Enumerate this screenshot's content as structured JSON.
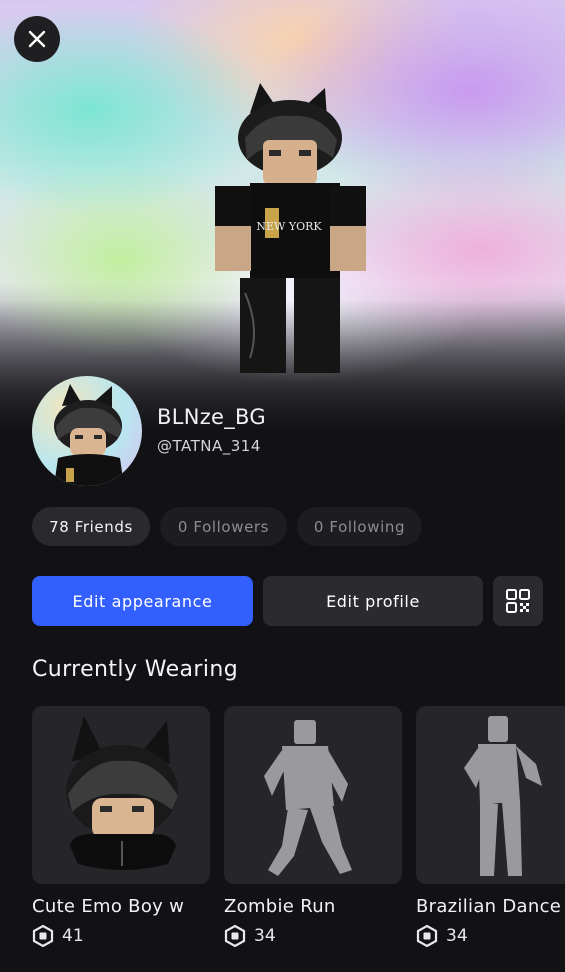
{
  "close": {
    "icon": "close-icon"
  },
  "profile": {
    "display_name": "BLNze_BG",
    "username": "@TATNA_314"
  },
  "stats": {
    "friends": "78 Friends",
    "followers": "0 Followers",
    "following": "0 Following"
  },
  "actions": {
    "edit_appearance": "Edit appearance",
    "edit_profile": "Edit profile",
    "qr_icon": "qr-code-icon"
  },
  "wearing": {
    "title": "Currently Wearing",
    "items": [
      {
        "name": "Cute Emo Boy w",
        "price": "41"
      },
      {
        "name": "Zombie Run",
        "price": "34"
      },
      {
        "name": "Brazilian Dance",
        "price": "34"
      }
    ]
  },
  "colors": {
    "primary": "#335fff",
    "background": "#121215",
    "card": "#25252a"
  }
}
